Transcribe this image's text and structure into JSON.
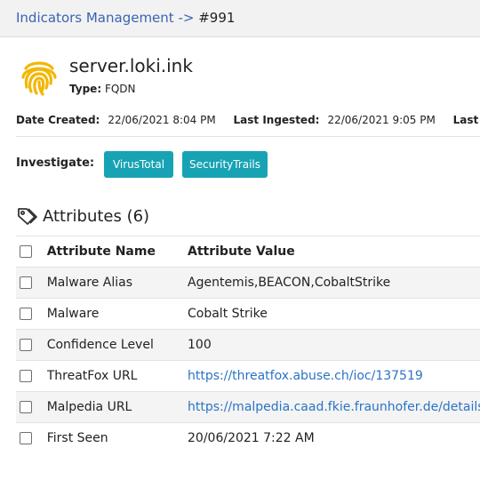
{
  "breadcrumb": {
    "parent": "Indicators Management",
    "separator": "->",
    "current": "#991"
  },
  "indicator": {
    "title": "server.loki.ink",
    "type_label": "Type:",
    "type_value": "FQDN",
    "icon": "fingerprint-icon"
  },
  "dates": {
    "created_label": "Date Created:",
    "created_value": "22/06/2021 8:04 PM",
    "ingested_label": "Last Ingested:",
    "ingested_value": "22/06/2021 9:05 PM",
    "modified_label": "Last M"
  },
  "investigate": {
    "label": "Investigate:",
    "buttons": [
      "VirusTotal",
      "SecurityTrails"
    ]
  },
  "attributes": {
    "title": "Attributes (6)",
    "icon": "tag-icon",
    "columns": [
      "Attribute Name",
      "Attribute Value"
    ],
    "rows": [
      {
        "name": "Malware Alias",
        "value": "Agentemis,BEACON,CobaltStrike",
        "is_link": false
      },
      {
        "name": "Malware",
        "value": "Cobalt Strike",
        "is_link": false
      },
      {
        "name": "Confidence Level",
        "value": "100",
        "is_link": false
      },
      {
        "name": "ThreatFox URL",
        "value": "https://threatfox.abuse.ch/ioc/137519",
        "is_link": true
      },
      {
        "name": "Malpedia URL",
        "value": "https://malpedia.caad.fkie.fraunhofer.de/details/",
        "is_link": true
      },
      {
        "name": "First Seen",
        "value": "20/06/2021 7:22 AM",
        "is_link": false
      }
    ]
  },
  "colors": {
    "accent_button": "#18a3b4",
    "link": "#2a74c4",
    "breadcrumb_link": "#3a64b0",
    "fingerprint": "#f2b705"
  }
}
